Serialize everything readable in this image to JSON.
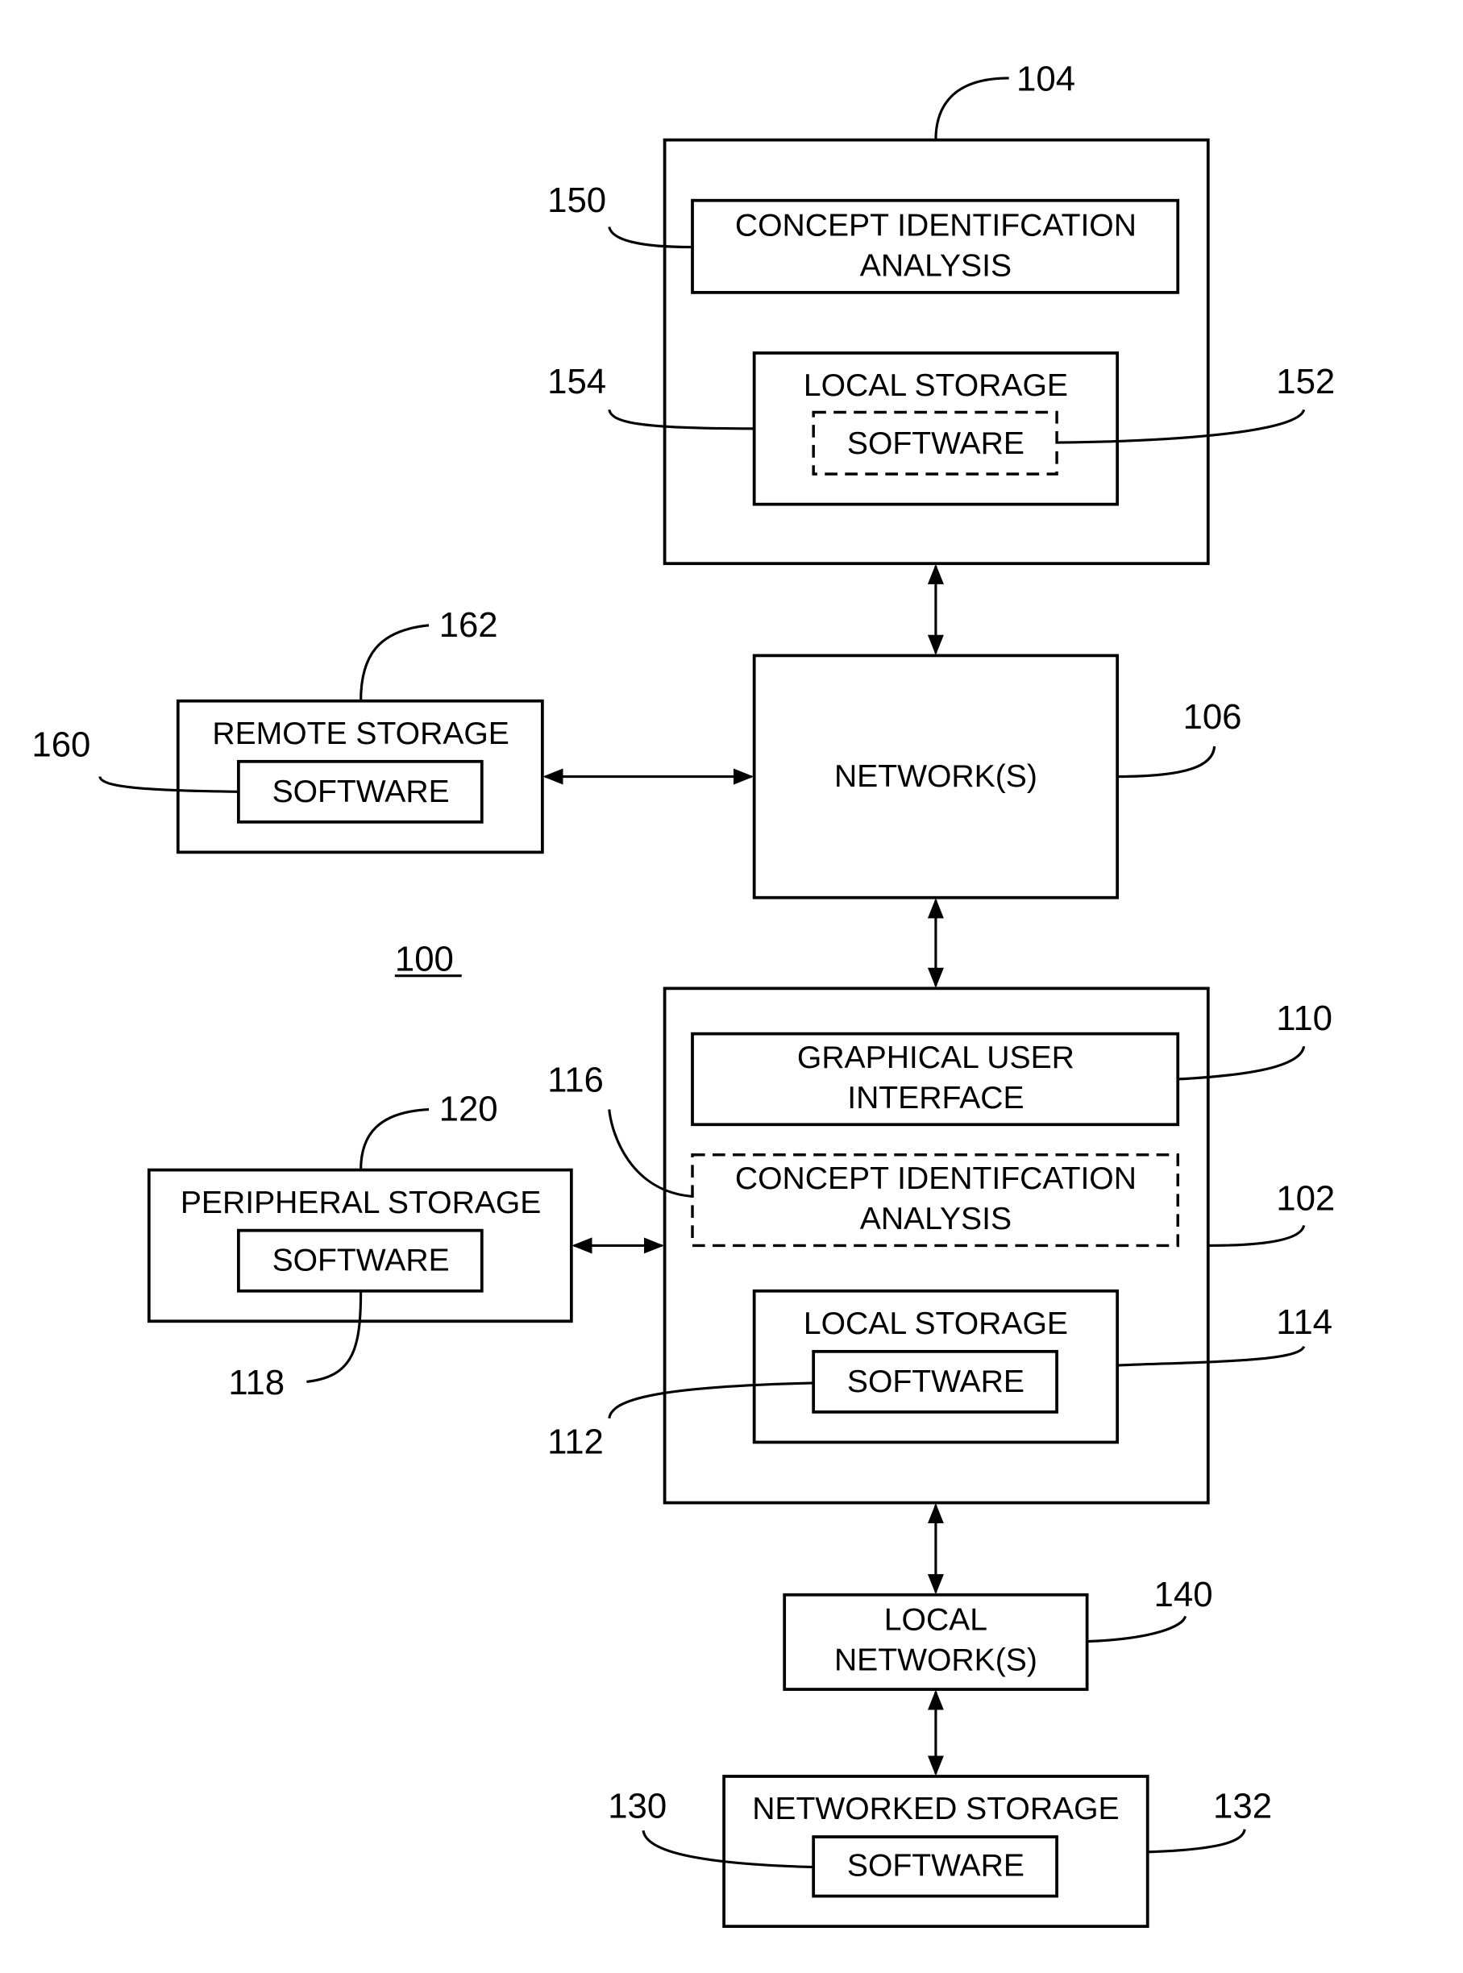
{
  "figure": {
    "figure_ref": "100",
    "server_104": {
      "ref": "104",
      "concept_box": {
        "ref": "150",
        "line1": "CONCEPT IDENTIFCATION",
        "line2": "ANALYSIS"
      },
      "local_storage": {
        "ref": "154",
        "label": "LOCAL STORAGE"
      },
      "software": {
        "ref": "152",
        "label": "SOFTWARE"
      }
    },
    "network_106": {
      "ref": "106",
      "label": "NETWORK(S)"
    },
    "remote_storage": {
      "ref": "162",
      "label": "REMOTE STORAGE",
      "software_ref": "160",
      "software_label": "SOFTWARE"
    },
    "client_102": {
      "ref": "102",
      "gui": {
        "ref": "110",
        "line1": "GRAPHICAL USER",
        "line2": "INTERFACE"
      },
      "concept_box": {
        "ref": "116",
        "line1": "CONCEPT IDENTIFCATION",
        "line2": "ANALYSIS"
      },
      "local_storage": {
        "ref": "114",
        "label": "LOCAL STORAGE"
      },
      "software": {
        "ref": "112",
        "label": "SOFTWARE"
      }
    },
    "peripheral_storage": {
      "ref": "120",
      "label": "PERIPHERAL STORAGE",
      "software_ref": "118",
      "software_label": "SOFTWARE"
    },
    "local_network": {
      "ref": "140",
      "line1": "LOCAL",
      "line2": "NETWORK(S)"
    },
    "networked_storage": {
      "ref": "132",
      "label": "NETWORKED STORAGE",
      "software_ref": "130",
      "software_label": "SOFTWARE"
    }
  }
}
